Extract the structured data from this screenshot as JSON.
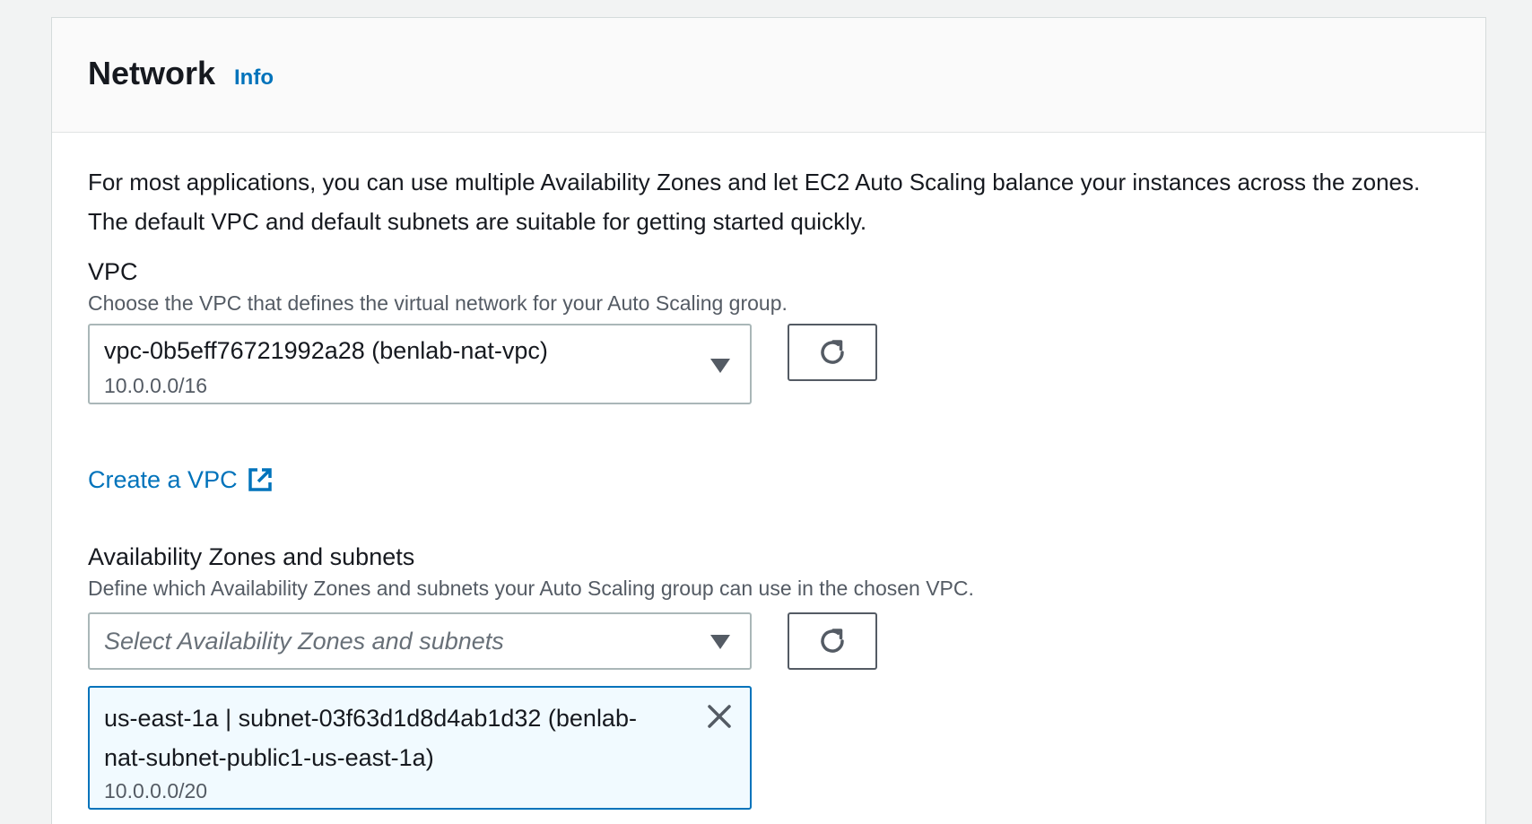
{
  "header": {
    "title": "Network",
    "info_label": "Info"
  },
  "description": "For most applications, you can use multiple Availability Zones and let EC2 Auto Scaling balance your instances across the zones. The default VPC and default subnets are suitable for getting started quickly.",
  "vpc": {
    "label": "VPC",
    "description": "Choose the VPC that defines the virtual network for your Auto Scaling group.",
    "selected_value": "vpc-0b5eff76721992a28 (benlab-nat-vpc)",
    "selected_cidr": "10.0.0.0/16",
    "create_link": "Create a VPC"
  },
  "subnets": {
    "label": "Availability Zones and subnets",
    "description": "Define which Availability Zones and subnets your Auto Scaling group can use in the chosen VPC.",
    "placeholder": "Select Availability Zones and subnets",
    "selected": [
      {
        "text": "us-east-1a | subnet-03f63d1d8d4ab1d32 (benlab-nat-subnet-public1-us-east-1a)",
        "cidr": "10.0.0.0/20"
      }
    ]
  },
  "icons": {
    "refresh": "refresh-icon",
    "dropdown": "caret-down-icon",
    "external": "external-link-icon",
    "remove": "close-icon"
  },
  "colors": {
    "link": "#0073bb",
    "token_bg": "#f1faff",
    "text": "#16191f",
    "secondary_text": "#545b64"
  }
}
